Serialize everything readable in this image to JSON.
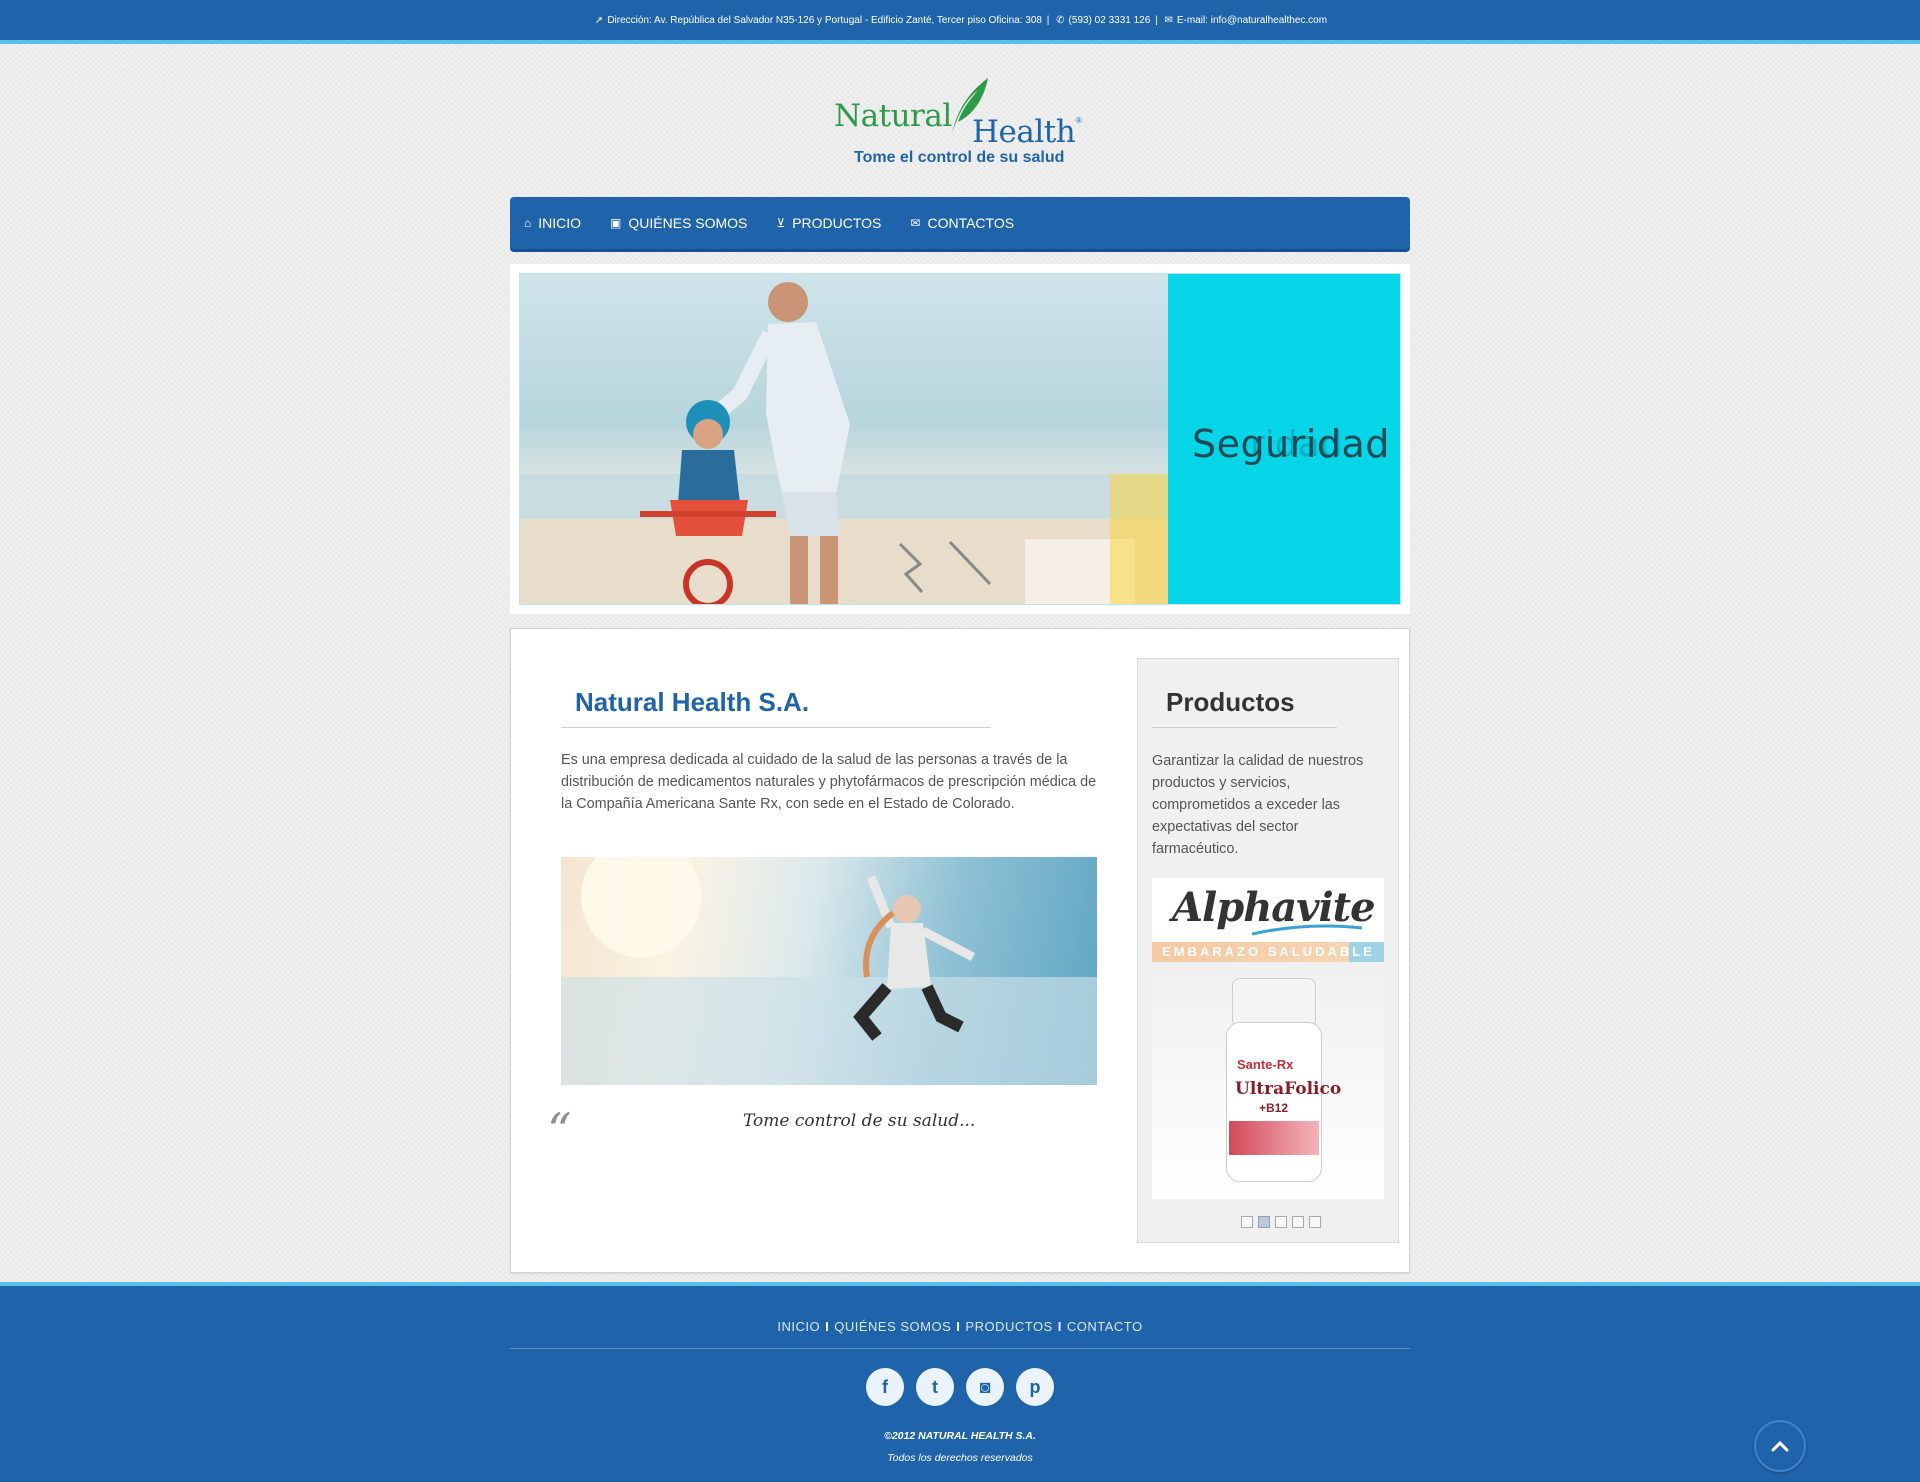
{
  "topbar": {
    "address": "Dirección: Av. República del Salvador N35-126 y Portugal - Edificio Zanté, Tercer piso Oficina: 308",
    "phone": "(593) 02 3331 126",
    "email": "E-mail: info@naturalhealthec.com",
    "separator": "|"
  },
  "logo": {
    "word1": "Natural",
    "word2": "Health",
    "registered": "®",
    "tagline": "Tome el control de su salud"
  },
  "nav": {
    "items": [
      {
        "label": "INICIO",
        "icon": "home-icon"
      },
      {
        "label": "QUIÉNES SOMOS",
        "icon": "briefcase-icon"
      },
      {
        "label": "PRODUCTOS",
        "icon": "cart-icon"
      },
      {
        "label": "CONTACTOS",
        "icon": "envelope-icon"
      }
    ]
  },
  "hero": {
    "caption": "Seguridad",
    "caption_ghost": "ridad"
  },
  "main": {
    "title": "Natural Health S.A.",
    "description": "Es una empresa dedicada al cuidado de la salud de las personas a través de la distribución de medicamentos naturales y phytofármacos de prescripción médica de la Compañía Americana Sante Rx, con sede en el Estado de Colorado.",
    "quote_mark": "“",
    "quote": "Tome control de su salud..."
  },
  "sidebar": {
    "title": "Productos",
    "text": "Garantizar la calidad de nuestros productos y servicios, comprometidos a exceder las expectativas del sector farmacéutico.",
    "product": {
      "brand": "Alphavite",
      "band": "EMBARAZO SALUDABLE",
      "bottle_brand": "Sante-Rx",
      "bottle_name": "UltraFolico",
      "bottle_sub": "+B12"
    },
    "slider_count": 5,
    "slider_active": 2
  },
  "footer": {
    "links": [
      "INICIO",
      "QUIÉNES SOMOS",
      "PRODUCTOS",
      "CONTACTO"
    ],
    "separator": "I",
    "socials": [
      "facebook-icon",
      "twitter-icon",
      "instagram-icon",
      "pinterest-icon"
    ],
    "social_glyphs": [
      "f",
      "t",
      "◙",
      "p"
    ],
    "copyright": "©2012 NATURAL HEALTH S.A.",
    "rights": "Todos los derechos reservados"
  },
  "colors": {
    "brand_blue": "#1f64ab",
    "accent_cyan": "#55c0ec",
    "hero_teal": "#06d6e7",
    "logo_green": "#2d9a48"
  }
}
